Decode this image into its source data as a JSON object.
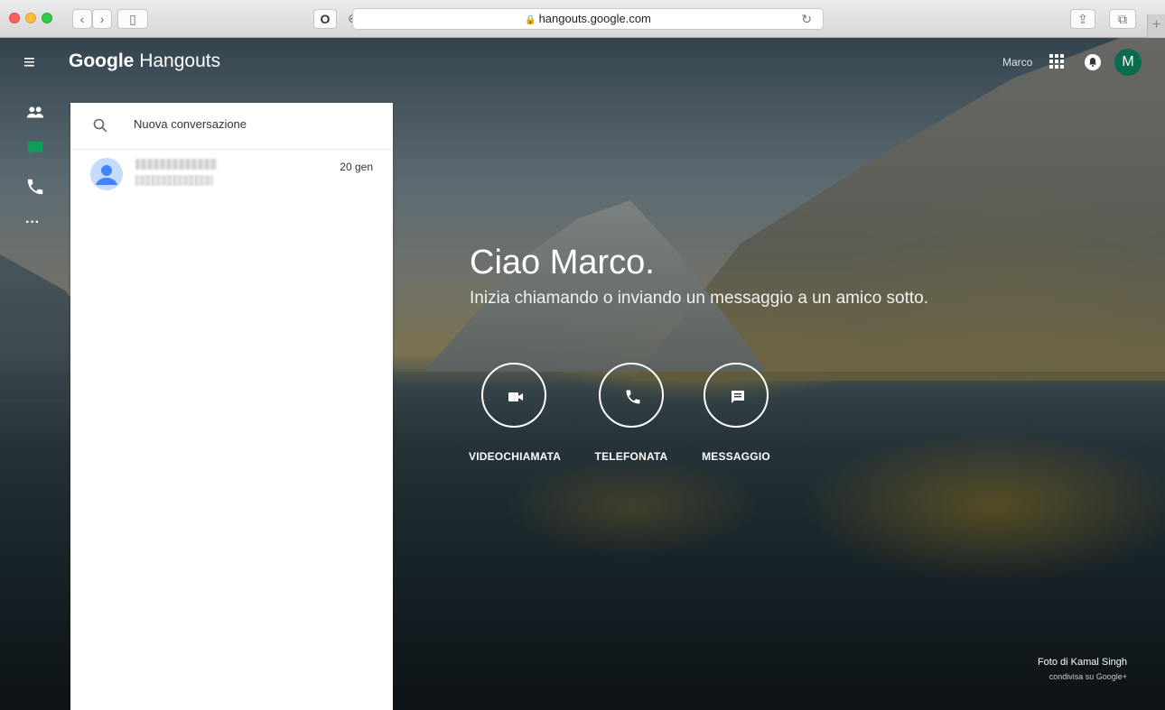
{
  "browser": {
    "url": "hangouts.google.com",
    "new_tab": "+"
  },
  "app": {
    "brand_google": "Google",
    "brand_product": "Hangouts",
    "username": "Marco",
    "avatar_initial": "M"
  },
  "search": {
    "placeholder": "Nuova conversazione"
  },
  "conversations": [
    {
      "name": "████████",
      "preview": "██████████",
      "date": "20 gen"
    }
  ],
  "welcome": {
    "title": "Ciao Marco.",
    "subtitle": "Inizia chiamando o inviando un messaggio a un amico sotto."
  },
  "actions": {
    "video": "VIDEOCHIAMATA",
    "phone": "TELEFONATA",
    "message": "MESSAGGIO"
  },
  "credit": {
    "line1": "Foto di Kamal Singh",
    "line2": "condivisa su Google+"
  },
  "colors": {
    "accent_green": "#0f9d58",
    "avatar_bg": "#0b6b4e"
  }
}
